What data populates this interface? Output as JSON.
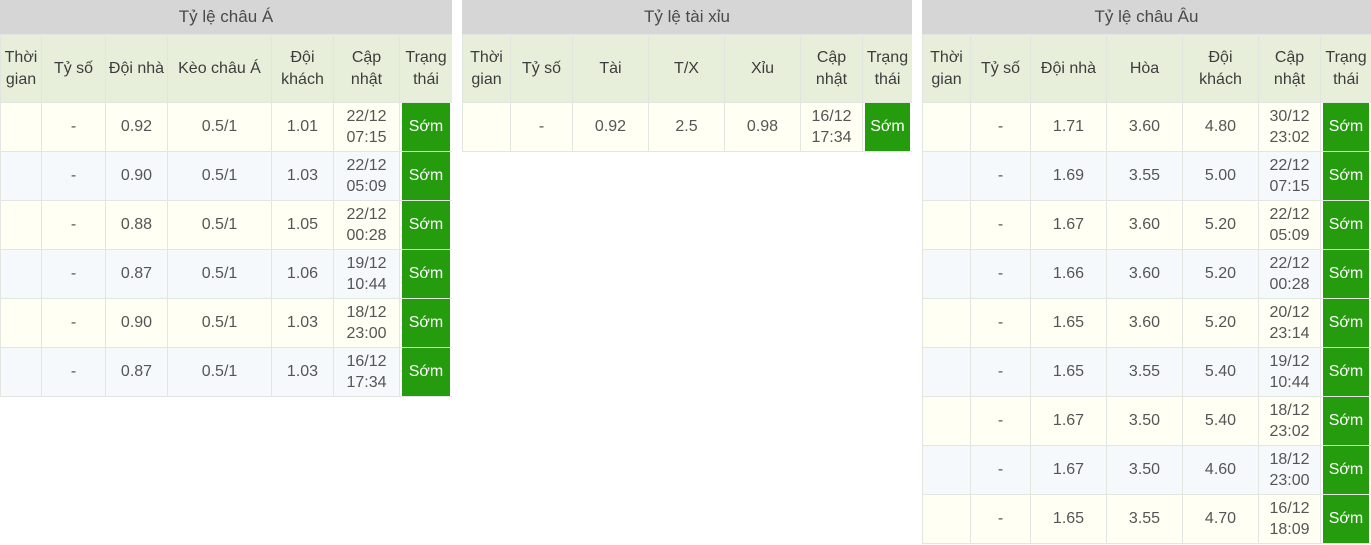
{
  "panels": [
    {
      "id": "asia",
      "title": "Tỷ lệ châu Á",
      "columns": [
        "Thời gian",
        "Tỷ số",
        "Đội nhà",
        "Kèo châu Á",
        "Đội khách",
        "Cập nhật",
        "Trạng thái"
      ],
      "rows": [
        {
          "time": "",
          "score": "-",
          "home": "0.92",
          "home_trend": "up",
          "handicap": "0.5/1",
          "handicap_trend": "flat",
          "away": "1.01",
          "away_trend": "down",
          "updated": [
            "22/12",
            "07:15"
          ],
          "status": "Sớm"
        },
        {
          "time": "",
          "score": "-",
          "home": "0.90",
          "home_trend": "up",
          "handicap": "0.5/1",
          "handicap_trend": "flat",
          "away": "1.03",
          "away_trend": "down",
          "updated": [
            "22/12",
            "05:09"
          ],
          "status": "Sớm"
        },
        {
          "time": "",
          "score": "-",
          "home": "0.88",
          "home_trend": "up",
          "handicap": "0.5/1",
          "handicap_trend": "flat",
          "away": "1.05",
          "away_trend": "down",
          "updated": [
            "22/12",
            "00:28"
          ],
          "status": "Sớm"
        },
        {
          "time": "",
          "score": "-",
          "home": "0.87",
          "home_trend": "down",
          "handicap": "0.5/1",
          "handicap_trend": "flat",
          "away": "1.06",
          "away_trend": "up",
          "updated": [
            "19/12",
            "10:44"
          ],
          "status": "Sớm"
        },
        {
          "time": "",
          "score": "-",
          "home": "0.90",
          "home_trend": "up",
          "handicap": "0.5/1",
          "handicap_trend": "flat",
          "away": "1.03",
          "away_trend": "flat",
          "updated": [
            "18/12",
            "23:00"
          ],
          "status": "Sớm"
        },
        {
          "time": "",
          "score": "-",
          "home": "0.87",
          "home_trend": "flat",
          "handicap": "0.5/1",
          "handicap_trend": "flat",
          "away": "1.03",
          "away_trend": "flat",
          "updated": [
            "16/12",
            "17:34"
          ],
          "status": "Sớm"
        }
      ]
    },
    {
      "id": "overunder",
      "title": "Tỷ lệ tài xỉu",
      "columns": [
        "Thời gian",
        "Tỷ số",
        "Tài",
        "T/X",
        "Xỉu",
        "Cập nhật",
        "Trạng thái"
      ],
      "rows": [
        {
          "time": "",
          "score": "-",
          "over": "0.92",
          "over_trend": "flat",
          "line": "2.5",
          "line_trend": "flat",
          "under": "0.98",
          "under_trend": "flat",
          "updated": [
            "16/12",
            "17:34"
          ],
          "status": "Sớm"
        }
      ]
    },
    {
      "id": "europe",
      "title": "Tỷ lệ châu Âu",
      "columns": [
        "Thời gian",
        "Tỷ số",
        "Đội nhà",
        "Hòa",
        "Đội khách",
        "Cập nhật",
        "Trạng thái"
      ],
      "rows": [
        {
          "time": "",
          "score": "-",
          "home": "1.71",
          "home_trend": "up",
          "draw": "3.60",
          "draw_trend": "up",
          "away": "4.80",
          "away_trend": "down",
          "updated": [
            "30/12",
            "23:02"
          ],
          "status": "Sớm"
        },
        {
          "time": "",
          "score": "-",
          "home": "1.69",
          "home_trend": "up",
          "draw": "3.55",
          "draw_trend": "down",
          "away": "5.00",
          "away_trend": "down",
          "updated": [
            "22/12",
            "07:15"
          ],
          "status": "Sớm"
        },
        {
          "time": "",
          "score": "-",
          "home": "1.67",
          "home_trend": "up",
          "draw": "3.60",
          "draw_trend": "flat",
          "away": "5.20",
          "away_trend": "flat",
          "updated": [
            "22/12",
            "05:09"
          ],
          "status": "Sớm"
        },
        {
          "time": "",
          "score": "-",
          "home": "1.66",
          "home_trend": "up",
          "draw": "3.60",
          "draw_trend": "flat",
          "away": "5.20",
          "away_trend": "flat",
          "updated": [
            "22/12",
            "00:28"
          ],
          "status": "Sớm"
        },
        {
          "time": "",
          "score": "-",
          "home": "1.65",
          "home_trend": "flat",
          "draw": "3.60",
          "draw_trend": "up",
          "away": "5.20",
          "away_trend": "down",
          "updated": [
            "20/12",
            "23:14"
          ],
          "status": "Sớm"
        },
        {
          "time": "",
          "score": "-",
          "home": "1.65",
          "home_trend": "down",
          "draw": "3.55",
          "draw_trend": "up",
          "away": "5.40",
          "away_trend": "flat",
          "updated": [
            "19/12",
            "10:44"
          ],
          "status": "Sớm"
        },
        {
          "time": "",
          "score": "-",
          "home": "1.67",
          "home_trend": "flat",
          "draw": "3.50",
          "draw_trend": "flat",
          "away": "5.40",
          "away_trend": "up",
          "updated": [
            "18/12",
            "23:02"
          ],
          "status": "Sớm"
        },
        {
          "time": "",
          "score": "-",
          "home": "1.67",
          "home_trend": "up",
          "draw": "3.50",
          "draw_trend": "down",
          "away": "4.60",
          "away_trend": "down",
          "updated": [
            "18/12",
            "23:00"
          ],
          "status": "Sớm"
        },
        {
          "time": "",
          "score": "-",
          "home": "1.65",
          "home_trend": "flat",
          "draw": "3.55",
          "draw_trend": "flat",
          "away": "4.70",
          "away_trend": "flat",
          "updated": [
            "16/12",
            "18:09"
          ],
          "status": "Sớm"
        }
      ]
    }
  ],
  "colors": {
    "title_bg": "#d6d6d6",
    "header_bg": "#e7efdb",
    "row_odd": "#fffff3",
    "row_even": "#f6f9fb",
    "status_green": "#259b0e",
    "up": "#17830b",
    "down": "#e8291e",
    "flat": "#555555"
  }
}
